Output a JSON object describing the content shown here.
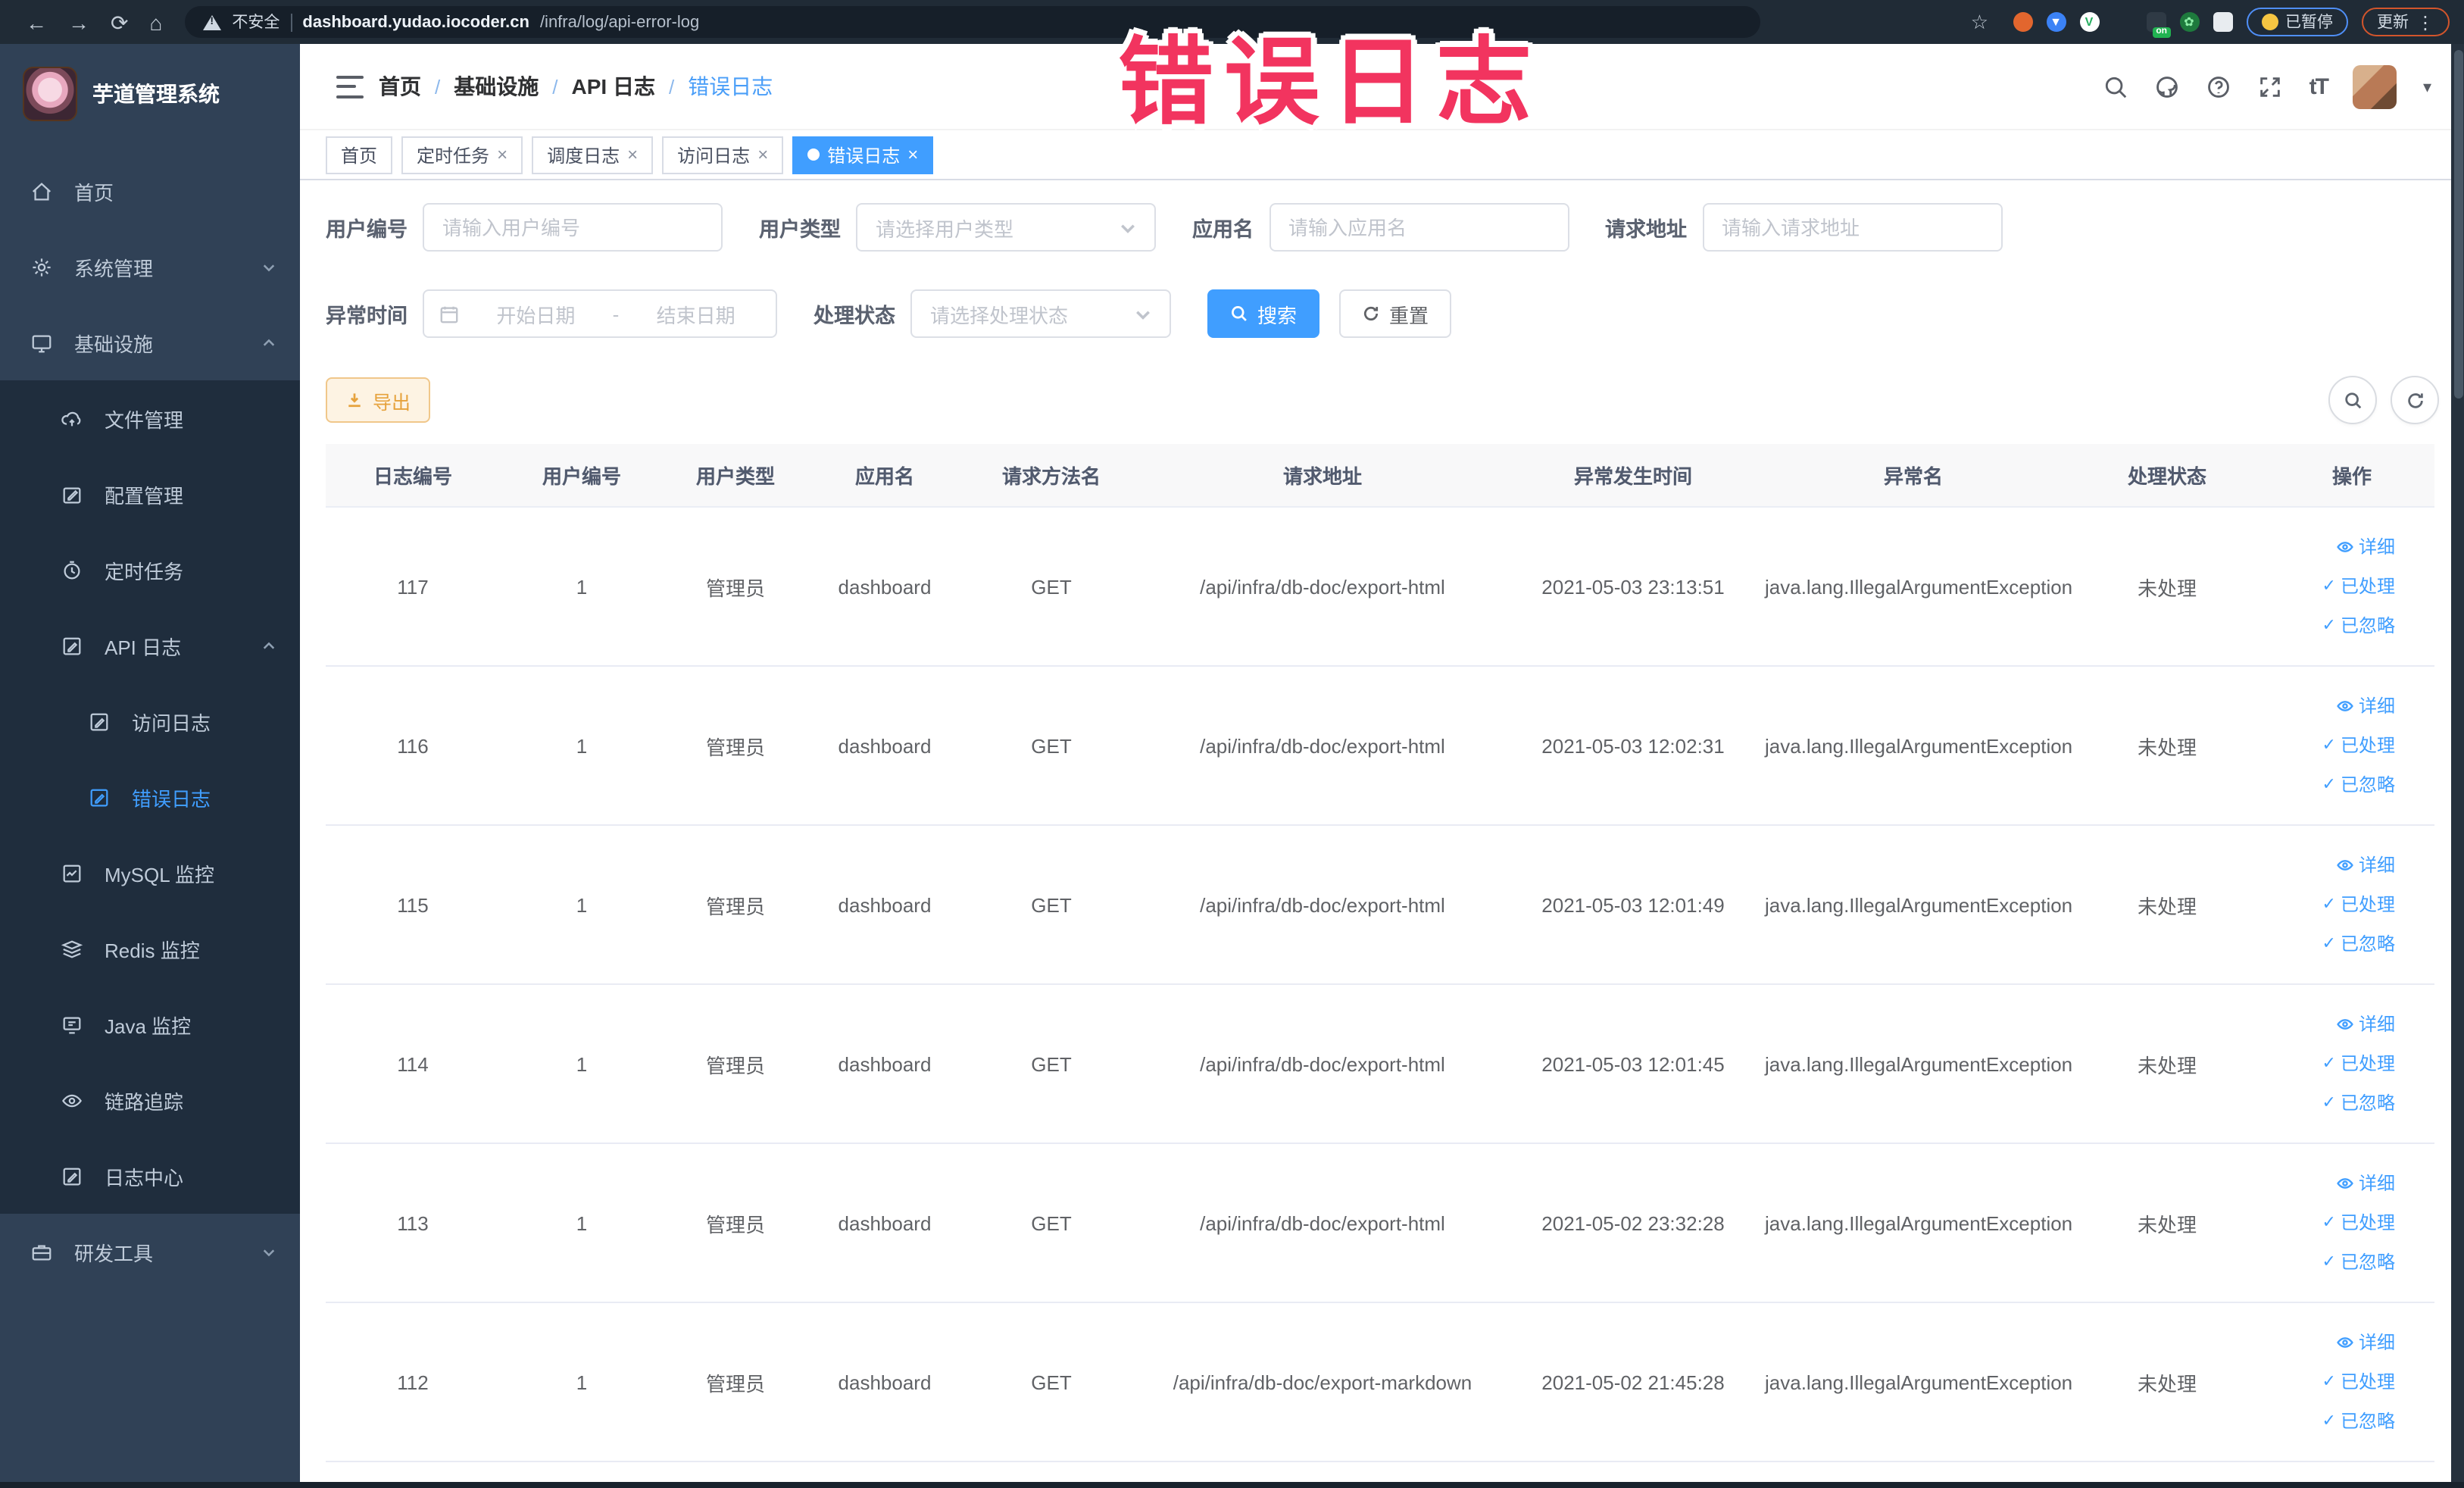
{
  "chrome": {
    "security_label": "不安全",
    "url_domain": "dashboard.yudao.iocoder.cn",
    "url_path": "/infra/log/api-error-log",
    "paused_pill": "已暂停",
    "update_pill": "更新"
  },
  "annotation": {
    "text": "错误日志",
    "color": "#f2345f"
  },
  "sidebar": {
    "title": "芋道管理系统",
    "menu": [
      {
        "label": "首页"
      },
      {
        "label": "系统管理"
      },
      {
        "label": "基础设施"
      },
      {
        "label": "文件管理"
      },
      {
        "label": "配置管理"
      },
      {
        "label": "定时任务"
      },
      {
        "label": "API 日志"
      },
      {
        "label": "访问日志"
      },
      {
        "label": "错误日志"
      },
      {
        "label": "MySQL 监控"
      },
      {
        "label": "Redis 监控"
      },
      {
        "label": "Java 监控"
      },
      {
        "label": "链路追踪"
      },
      {
        "label": "日志中心"
      },
      {
        "label": "研发工具"
      }
    ]
  },
  "header": {
    "breadcrumb": [
      "首页",
      "基础设施",
      "API 日志",
      "错误日志"
    ]
  },
  "tags": [
    {
      "label": "首页",
      "closable": false,
      "active": false
    },
    {
      "label": "定时任务",
      "closable": true,
      "active": false
    },
    {
      "label": "调度日志",
      "closable": true,
      "active": false
    },
    {
      "label": "访问日志",
      "closable": true,
      "active": false
    },
    {
      "label": "错误日志",
      "closable": true,
      "active": true
    }
  ],
  "filters": {
    "user_id": {
      "label": "用户编号",
      "placeholder": "请输入用户编号"
    },
    "user_type": {
      "label": "用户类型",
      "placeholder": "请选择用户类型"
    },
    "app_name": {
      "label": "应用名",
      "placeholder": "请输入应用名"
    },
    "request_url": {
      "label": "请求地址",
      "placeholder": "请输入请求地址"
    },
    "exception_time": {
      "label": "异常时间",
      "start_placeholder": "开始日期",
      "separator": "-",
      "end_placeholder": "结束日期"
    },
    "process_status": {
      "label": "处理状态",
      "placeholder": "请选择处理状态"
    },
    "search_button": "搜索",
    "reset_button": "重置"
  },
  "toolbar": {
    "export_button": "导出"
  },
  "table": {
    "columns": [
      "日志编号",
      "用户编号",
      "用户类型",
      "应用名",
      "请求方法名",
      "请求地址",
      "异常发生时间",
      "异常名",
      "处理状态",
      "操作"
    ],
    "actions": [
      "详细",
      "已处理",
      "已忽略"
    ],
    "rows": [
      {
        "id": "117",
        "user_id": "1",
        "user_type": "管理员",
        "app": "dashboard",
        "method": "GET",
        "url": "/api/infra/db-doc/export-html",
        "time": "2021-05-03 23:13:51",
        "exception": "java.lang.IllegalArgumentException",
        "status": "未处理"
      },
      {
        "id": "116",
        "user_id": "1",
        "user_type": "管理员",
        "app": "dashboard",
        "method": "GET",
        "url": "/api/infra/db-doc/export-html",
        "time": "2021-05-03 12:02:31",
        "exception": "java.lang.IllegalArgumentException",
        "status": "未处理"
      },
      {
        "id": "115",
        "user_id": "1",
        "user_type": "管理员",
        "app": "dashboard",
        "method": "GET",
        "url": "/api/infra/db-doc/export-html",
        "time": "2021-05-03 12:01:49",
        "exception": "java.lang.IllegalArgumentException",
        "status": "未处理"
      },
      {
        "id": "114",
        "user_id": "1",
        "user_type": "管理员",
        "app": "dashboard",
        "method": "GET",
        "url": "/api/infra/db-doc/export-html",
        "time": "2021-05-03 12:01:45",
        "exception": "java.lang.IllegalArgumentException",
        "status": "未处理"
      },
      {
        "id": "113",
        "user_id": "1",
        "user_type": "管理员",
        "app": "dashboard",
        "method": "GET",
        "url": "/api/infra/db-doc/export-html",
        "time": "2021-05-02 23:32:28",
        "exception": "java.lang.IllegalArgumentException",
        "status": "未处理"
      },
      {
        "id": "112",
        "user_id": "1",
        "user_type": "管理员",
        "app": "dashboard",
        "method": "GET",
        "url": "/api/infra/db-doc/export-markdown",
        "time": "2021-05-02 21:45:28",
        "exception": "java.lang.IllegalArgumentException",
        "status": "未处理"
      }
    ]
  },
  "colors": {
    "accent": "#409eff",
    "sidebar_bg": "#304156",
    "submenu_bg": "#1f2d3d",
    "warning": "#e6a23c",
    "annotation": "#f2345f"
  }
}
